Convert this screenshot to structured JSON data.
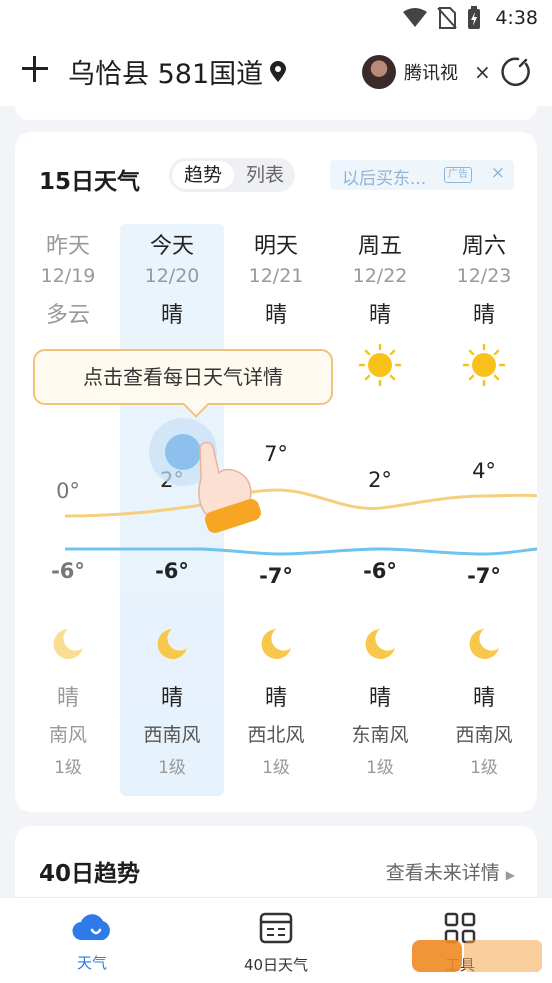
{
  "status": {
    "time": "4:38"
  },
  "header": {
    "city": "乌恰县 581国道",
    "ad_label": "腾讯视",
    "close": "×"
  },
  "card15": {
    "title": "15日天气",
    "seg_on": "趋势",
    "seg_off": "列表",
    "ad_text": "以后买东...",
    "ad_tag": "广告",
    "ad_close": "×",
    "tooltip": "点击查看每日天气详情",
    "days": [
      {
        "name": "昨天",
        "date": "12/19",
        "cond": "多云",
        "high": "0°",
        "low": "-6°",
        "night": "晴",
        "wind": "南风",
        "level": "1级"
      },
      {
        "name": "今天",
        "date": "12/20",
        "cond": "晴",
        "high": "2°",
        "low": "-6°",
        "night": "晴",
        "wind": "西南风",
        "level": "1级"
      },
      {
        "name": "明天",
        "date": "12/21",
        "cond": "晴",
        "high": "7°",
        "low": "-7°",
        "night": "晴",
        "wind": "西北风",
        "level": "1级"
      },
      {
        "name": "周五",
        "date": "12/22",
        "cond": "晴",
        "high": "2°",
        "low": "-6°",
        "night": "晴",
        "wind": "东南风",
        "level": "1级"
      },
      {
        "name": "周六",
        "date": "12/23",
        "cond": "晴",
        "high": "4°",
        "low": "-7°",
        "night": "晴",
        "wind": "西南风",
        "level": "1级"
      }
    ]
  },
  "card40": {
    "title": "40日趋势",
    "link": "查看未来详情"
  },
  "tabs": [
    {
      "label": "天气",
      "icon": "cloud-icon"
    },
    {
      "label": "40日天气",
      "icon": "calendar-icon"
    },
    {
      "label": "工具",
      "icon": "grid-icon"
    }
  ],
  "colors": {
    "accent": "#2d7ae8",
    "high_line": "#f5cf7e",
    "low_line": "#6ec3ef",
    "sun": "#f9c21b"
  }
}
